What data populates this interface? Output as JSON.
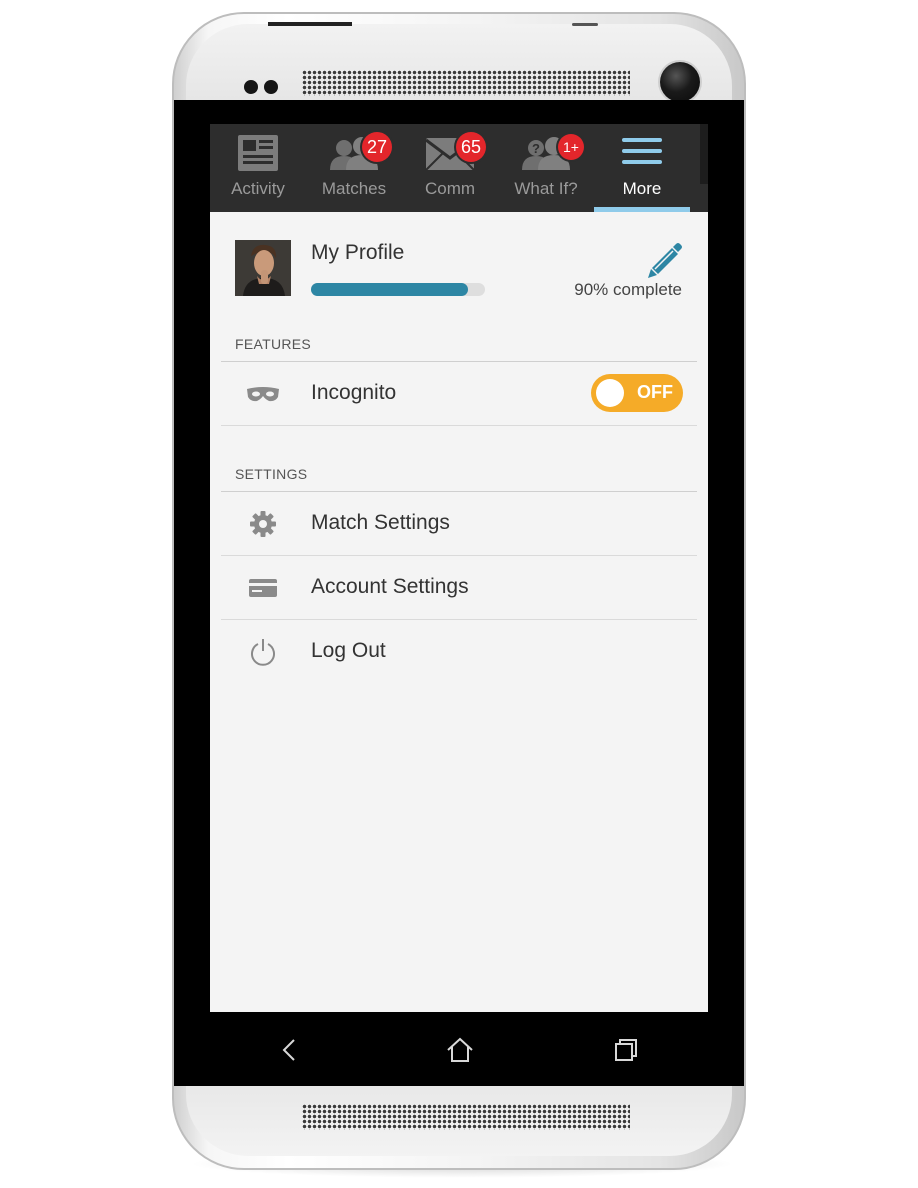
{
  "tabs": [
    {
      "label": "Activity",
      "icon": "newspaper-icon",
      "badge": ""
    },
    {
      "label": "Matches",
      "icon": "people-icon",
      "badge": "27"
    },
    {
      "label": "Comm",
      "icon": "envelope-icon",
      "badge": "65"
    },
    {
      "label": "What If?",
      "icon": "question-people-icon",
      "badge": "1+"
    },
    {
      "label": "More",
      "icon": "hamburger-icon",
      "badge": "",
      "active": true
    }
  ],
  "profile": {
    "title": "My Profile",
    "completion_percent": 90,
    "completion_text": "90% complete",
    "edit_icon": "pencil-icon"
  },
  "features": {
    "header": "FEATURES",
    "incognito": {
      "label": "Incognito",
      "icon": "mask-icon",
      "toggle_text": "OFF",
      "enabled": false
    }
  },
  "settings": {
    "header": "SETTINGS",
    "items": [
      {
        "label": "Match Settings",
        "icon": "gear-icon"
      },
      {
        "label": "Account Settings",
        "icon": "credit-card-icon"
      },
      {
        "label": "Log Out",
        "icon": "power-icon"
      }
    ]
  },
  "colors": {
    "tabbar_bg": "#2d2d2d",
    "active_indicator": "#8fcbea",
    "badge": "#e3262b",
    "progress": "#2d86a4",
    "toggle": "#f5ab28",
    "content_bg": "#f4f4f4"
  }
}
